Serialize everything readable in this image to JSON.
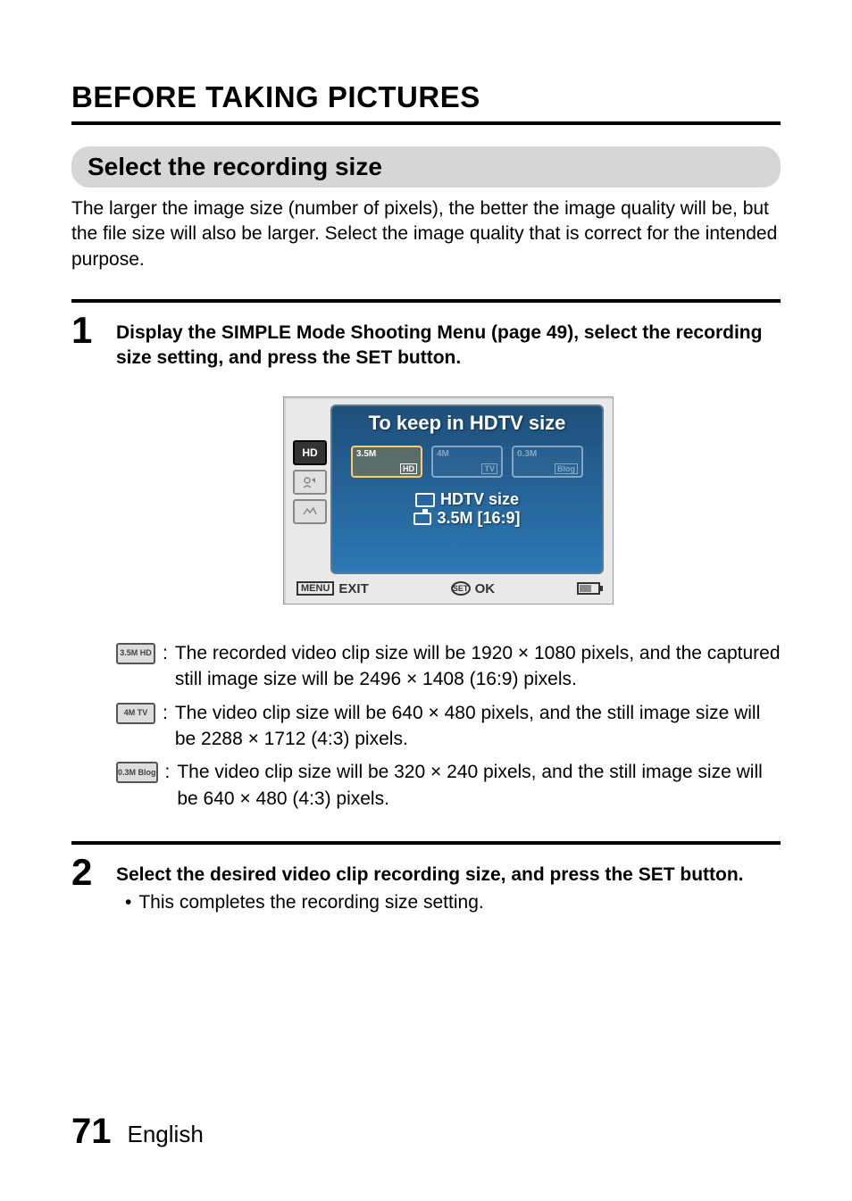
{
  "heading": "BEFORE TAKING PICTURES",
  "subheading": "Select the recording size",
  "intro": "The larger the image size (number of pixels), the better the image quality will be, but the file size will also be larger. Select the image quality that is correct for the intended purpose.",
  "step1": {
    "number": "1",
    "text": "Display the SIMPLE Mode Shooting Menu (page 49), select the recording size setting, and press the SET button."
  },
  "lcd": {
    "title": "To keep in HDTV size",
    "tab_hd": "HD",
    "options": {
      "opt1_top": "3.5M",
      "opt1_bot": "HD",
      "opt2_top": "4M",
      "opt2_bot": "TV",
      "opt3_top": "0.3M",
      "opt3_bot": "Blog"
    },
    "desc_line1": "HDTV size",
    "desc_line2": "3.5M [16:9]",
    "menu_label": "MENU",
    "exit_label": "EXIT",
    "set_label": "SET",
    "ok_label": "OK"
  },
  "iconlist": {
    "item1_icon": "3.5M HD",
    "item1_text": "The recorded video clip size will be 1920 × 1080 pixels, and the captured still image size will be 2496 × 1408 (16:9) pixels.",
    "item2_icon": "4M TV",
    "item2_text": "The video clip size will be 640 × 480 pixels, and the still image size will be 2288 × 1712 (4:3) pixels.",
    "item3_icon": "0.3M Blog",
    "item3_text": "The video clip size will be 320 × 240 pixels, and the still image size will be 640 × 480 (4:3) pixels."
  },
  "step2": {
    "number": "2",
    "text": "Select the desired video clip recording size, and press the SET button.",
    "bullet": "This completes the recording size setting."
  },
  "footer": {
    "page": "71",
    "lang": "English"
  }
}
